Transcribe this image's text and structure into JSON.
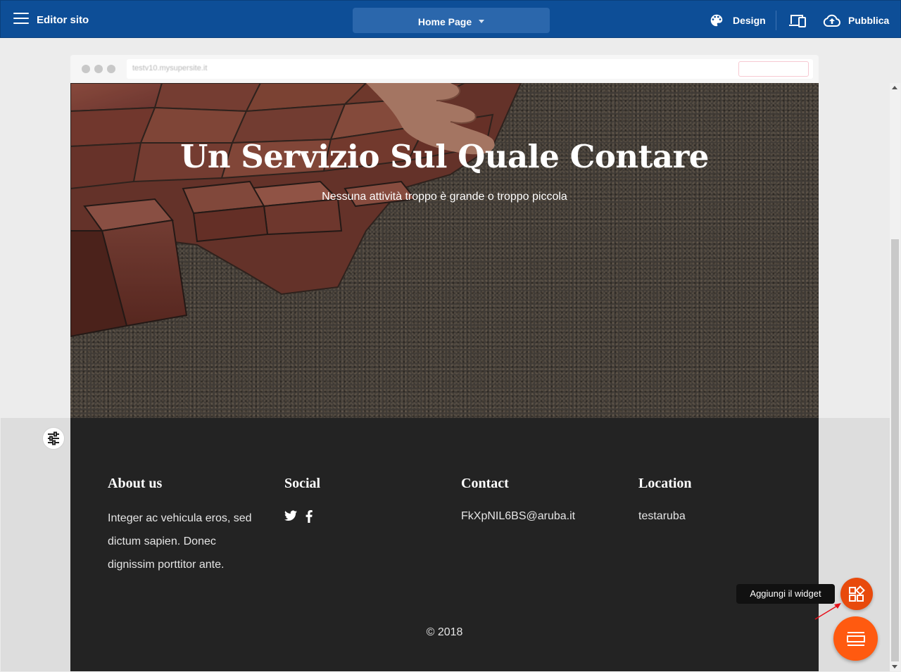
{
  "topbar": {
    "editor_title": "Editor sito",
    "page_selector": "Home Page",
    "design_label": "Design",
    "publish_label": "Pubblica"
  },
  "browser": {
    "url": "testv10.mysupersite.it"
  },
  "hero": {
    "title": "Un Servizio Sul Quale Contare",
    "subtitle": "Nessuna attività troppo è grande o troppo piccola"
  },
  "footer": {
    "about": {
      "heading": "About us",
      "text": "Integer ac vehicula eros, sed dictum sapien. Donec dignissim porttitor ante."
    },
    "social": {
      "heading": "Social",
      "icons": [
        "twitter-icon",
        "facebook-icon"
      ]
    },
    "contact": {
      "heading": "Contact",
      "email": "FkXpNIL6BS@aruba.it"
    },
    "location": {
      "heading": "Location",
      "text": "testaruba"
    },
    "copyright": "© 2018"
  },
  "floating": {
    "tooltip": "Aggiungi il widget"
  },
  "colors": {
    "topbar": "#0d4e97",
    "page_selector": "#2b67ac",
    "widget_button": "#e84a0c",
    "section_button": "#ff5a10",
    "footer": "#232323"
  }
}
